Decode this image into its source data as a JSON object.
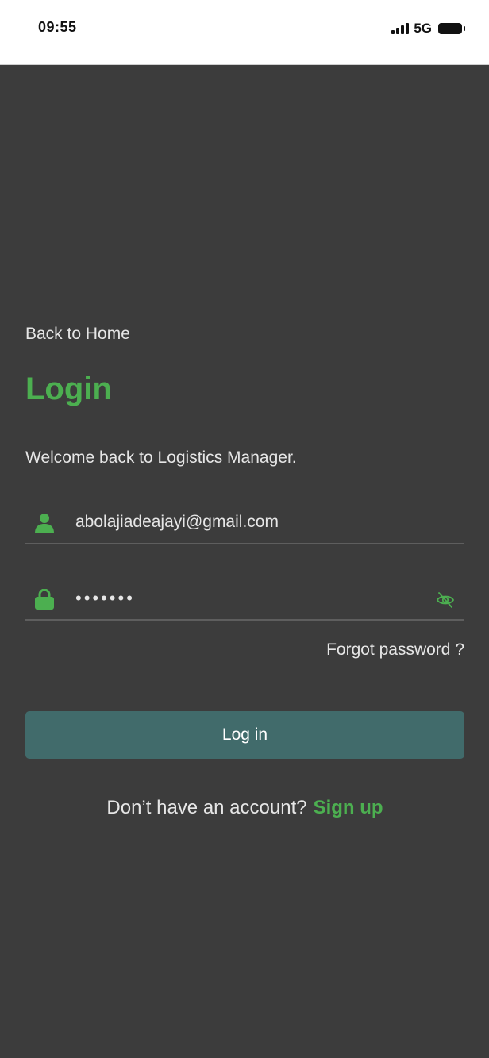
{
  "status_bar": {
    "time": "09:55",
    "network": "5G",
    "icons": [
      "signal-icon",
      "battery-icon"
    ]
  },
  "back_link": "Back to Home",
  "title": "Login",
  "welcome": "Welcome back to Logistics Manager.",
  "email_field": {
    "value": "abolajiadeajayi@gmail.com",
    "icon": "user-icon"
  },
  "password_field": {
    "value": "•••••••",
    "icon": "lock-icon",
    "toggle_icon": "eye-off-icon"
  },
  "forgot_password": "Forgot password ?",
  "login_button": "Log in",
  "signup": {
    "prompt": "Don’t have an account?",
    "link": "Sign up"
  },
  "colors": {
    "background": "#3c3c3c",
    "accent": "#4caf50",
    "button": "#416b6b",
    "text": "#e6e6e6"
  }
}
